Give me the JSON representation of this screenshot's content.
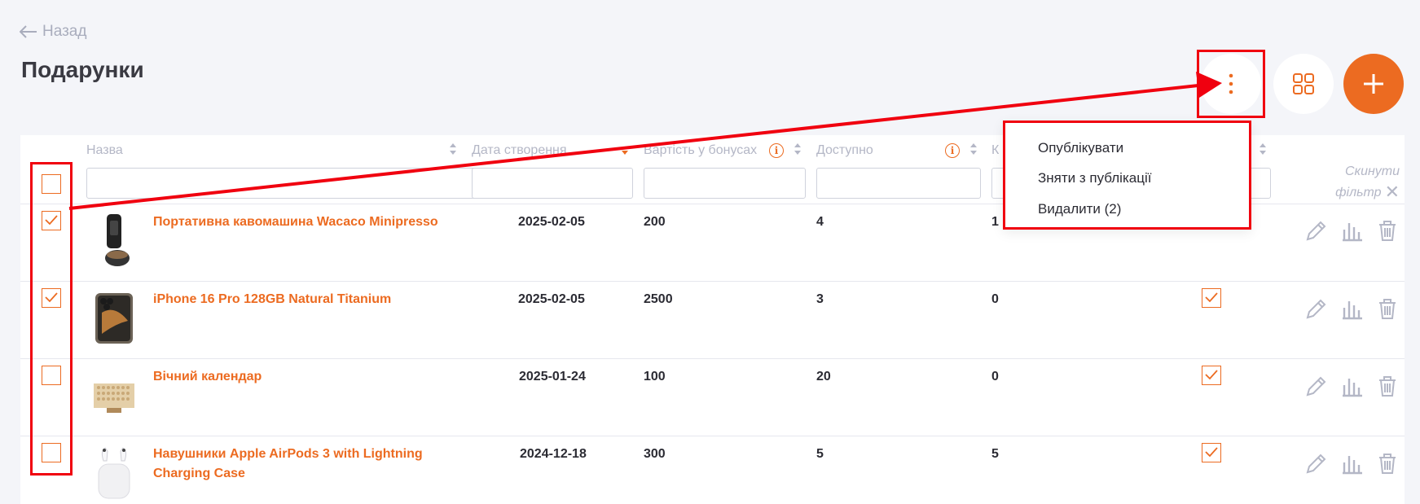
{
  "header": {
    "back_label": "Назад",
    "title": "Подарунки"
  },
  "table": {
    "columns": [
      {
        "label": "Назва"
      },
      {
        "label": "Дата створення"
      },
      {
        "label": "Вартість у бонусах"
      },
      {
        "label": "Доступно"
      },
      {
        "label": "К"
      }
    ],
    "reset_filter_line1": "Скинути",
    "reset_filter_line2": "фільтр",
    "rows": [
      {
        "name": "Портативна кавомашина Wacaco Minipresso",
        "date": "2025-02-05",
        "cost": "200",
        "available": "4",
        "count": "1",
        "selected": true,
        "published": null
      },
      {
        "name": "iPhone 16 Pro 128GB Natural Titanium",
        "date": "2025-02-05",
        "cost": "2500",
        "available": "3",
        "count": "0",
        "selected": true,
        "published": true
      },
      {
        "name": "Вічний календар",
        "date": "2025-01-24",
        "cost": "100",
        "available": "20",
        "count": "0",
        "selected": false,
        "published": true
      },
      {
        "name": "Навушники Apple AirPods 3 with Lightning Charging Case",
        "date": "2024-12-18",
        "cost": "300",
        "available": "5",
        "count": "5",
        "selected": false,
        "published": true
      }
    ]
  },
  "menu": {
    "items": [
      "Опублікувати",
      "Зняти з публікації",
      "Видалити (2)"
    ]
  },
  "colors": {
    "accent": "#ec6b21",
    "highlight": "#f0000f",
    "background": "#f4f5f9"
  },
  "icons": [
    "arrow-left-icon",
    "more-vertical-icon",
    "grid-icon",
    "plus-icon",
    "info-icon",
    "sort-icon",
    "edit-icon",
    "stats-icon",
    "trash-icon"
  ]
}
